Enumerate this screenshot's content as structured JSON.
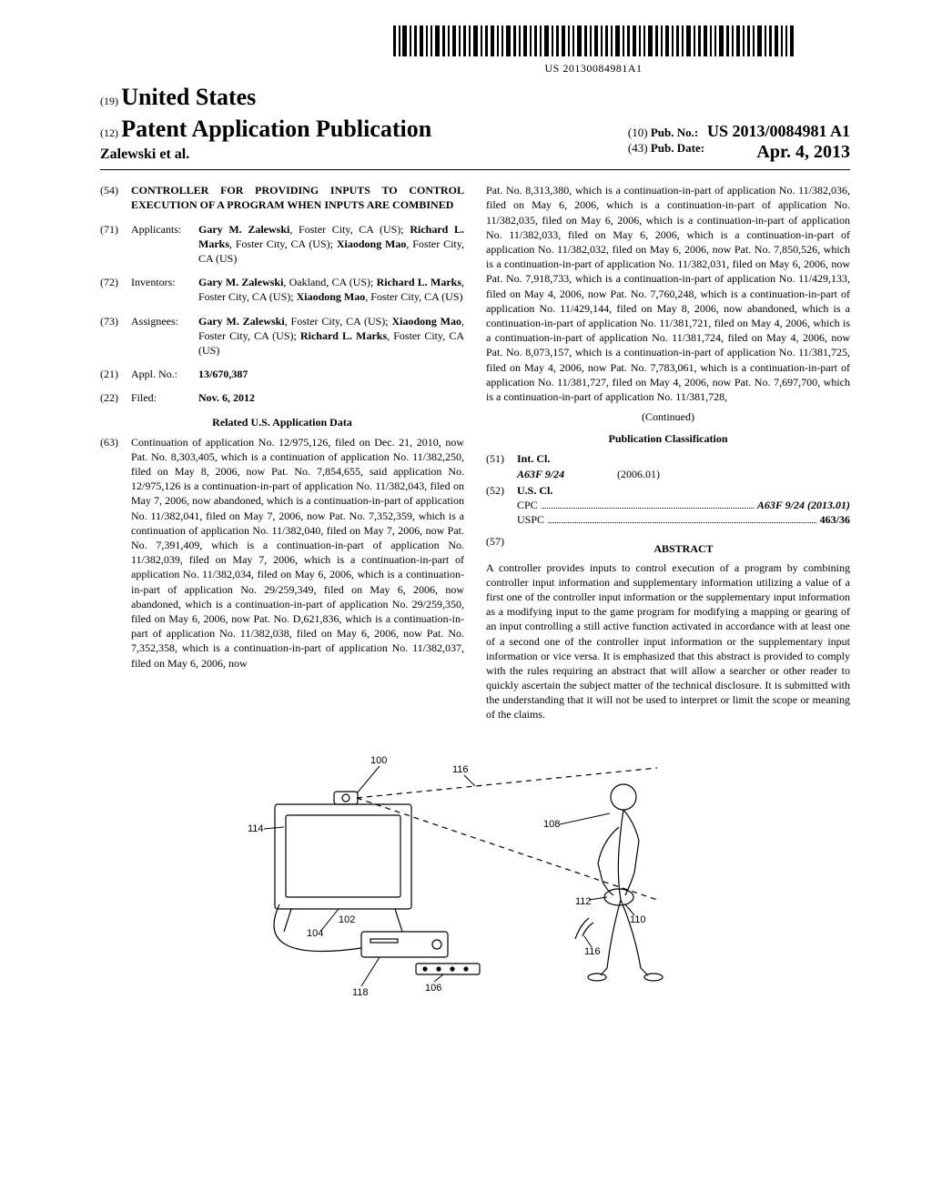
{
  "barcode_text": "US 20130084981A1",
  "header": {
    "country_num": "(19)",
    "country": "United States",
    "doc_num": "(12)",
    "doc_type": "Patent Application Publication",
    "authors": "Zalewski et al.",
    "pub_no_num": "(10)",
    "pub_no_label": "Pub. No.:",
    "pub_no": "US 2013/0084981 A1",
    "pub_date_num": "(43)",
    "pub_date_label": "Pub. Date:",
    "pub_date": "Apr. 4, 2013"
  },
  "left_col": {
    "title_num": "(54)",
    "title": "CONTROLLER FOR PROVIDING INPUTS TO CONTROL EXECUTION OF A PROGRAM WHEN INPUTS ARE COMBINED",
    "applicants_num": "(71)",
    "applicants_label": "Applicants:",
    "applicants": "Gary M. Zalewski, Foster City, CA (US); Richard L. Marks, Foster City, CA (US); Xiaodong Mao, Foster City, CA (US)",
    "inventors_num": "(72)",
    "inventors_label": "Inventors:",
    "inventors": "Gary M. Zalewski, Oakland, CA (US); Richard L. Marks, Foster City, CA (US); Xiaodong Mao, Foster City, CA (US)",
    "assignees_num": "(73)",
    "assignees_label": "Assignees:",
    "assignees": "Gary M. Zalewski, Foster City, CA (US); Xiaodong Mao, Foster City, CA (US); Richard L. Marks, Foster City, CA (US)",
    "appl_num": "(21)",
    "appl_label": "Appl. No.:",
    "appl_no": "13/670,387",
    "filed_num": "(22)",
    "filed_label": "Filed:",
    "filed": "Nov. 6, 2012",
    "related_heading": "Related U.S. Application Data",
    "continuation_num": "(63)",
    "continuation": "Continuation of application No. 12/975,126, filed on Dec. 21, 2010, now Pat. No. 8,303,405, which is a continuation of application No. 11/382,250, filed on May 8, 2006, now Pat. No. 7,854,655, said application No. 12/975,126 is a continuation-in-part of application No. 11/382,043, filed on May 7, 2006, now abandoned, which is a continuation-in-part of application No. 11/382,041, filed on May 7, 2006, now Pat. No. 7,352,359, which is a continuation of application No. 11/382,040, filed on May 7, 2006, now Pat. No. 7,391,409, which is a continuation-in-part of application No. 11/382,039, filed on May 7, 2006, which is a continuation-in-part of application No. 11/382,034, filed on May 6, 2006, which is a continuation-in-part of application No. 29/259,349, filed on May 6, 2006, now abandoned, which is a continuation-in-part of application No. 29/259,350, filed on May 6, 2006, now Pat. No. D,621,836, which is a continuation-in-part of application No. 11/382,038, filed on May 6, 2006, now Pat. No. 7,352,358, which is a continuation-in-part of application No. 11/382,037, filed on May 6, 2006, now"
  },
  "right_col": {
    "continuation_top": "Pat. No. 8,313,380, which is a continuation-in-part of application No. 11/382,036, filed on May 6, 2006, which is a continuation-in-part of application No. 11/382,035, filed on May 6, 2006, which is a continuation-in-part of application No. 11/382,033, filed on May 6, 2006, which is a continuation-in-part of application No. 11/382,032, filed on May 6, 2006, now Pat. No. 7,850,526, which is a continuation-in-part of application No. 11/382,031, filed on May 6, 2006, now Pat. No. 7,918,733, which is a continuation-in-part of application No. 11/429,133, filed on May 4, 2006, now Pat. No. 7,760,248, which is a continuation-in-part of application No. 11/429,144, filed on May 8, 2006, now abandoned, which is a continuation-in-part of application No. 11/381,721, filed on May 4, 2006, which is a continuation-in-part of application No. 11/381,724, filed on May 4, 2006, now Pat. No. 8,073,157, which is a continuation-in-part of application No. 11/381,725, filed on May 4, 2006, now Pat. No. 7,783,061, which is a continuation-in-part of application No. 11/381,727, filed on May 4, 2006, now Pat. No. 7,697,700, which is a continuation-in-part of application No. 11/381,728,",
    "continued": "(Continued)",
    "pub_class_heading": "Publication Classification",
    "int_cl_num": "(51)",
    "int_cl_label": "Int. Cl.",
    "int_cl_code": "A63F 9/24",
    "int_cl_ver": "(2006.01)",
    "us_cl_num": "(52)",
    "us_cl_label": "U.S. Cl.",
    "cpc_label": "CPC",
    "cpc_val": "A63F 9/24 (2013.01)",
    "uspc_label": "USPC",
    "uspc_val": "463/36",
    "abstract_num": "(57)",
    "abstract_label": "ABSTRACT",
    "abstract": "A controller provides inputs to control execution of a program by combining controller input information and supplementary information utilizing a value of a first one of the controller input information or the supplementary input information as a modifying input to the game program for modifying a mapping or gearing of an input controlling a still active function activated in accordance with at least one of a second one of the controller input information or the supplementary input information or vice versa. It is emphasized that this abstract is provided to comply with the rules requiring an abstract that will allow a searcher or other reader to quickly ascertain the subject matter of the technical disclosure. It is submitted with the understanding that it will not be used to interpret or limit the scope or meaning of the claims."
  },
  "figure_refs": {
    "r100": "100",
    "r102": "102",
    "r104": "104",
    "r106": "106",
    "r108": "108",
    "r110": "110",
    "r112": "112",
    "r114": "114",
    "r116a": "116",
    "r116b": "116",
    "r118": "118"
  }
}
